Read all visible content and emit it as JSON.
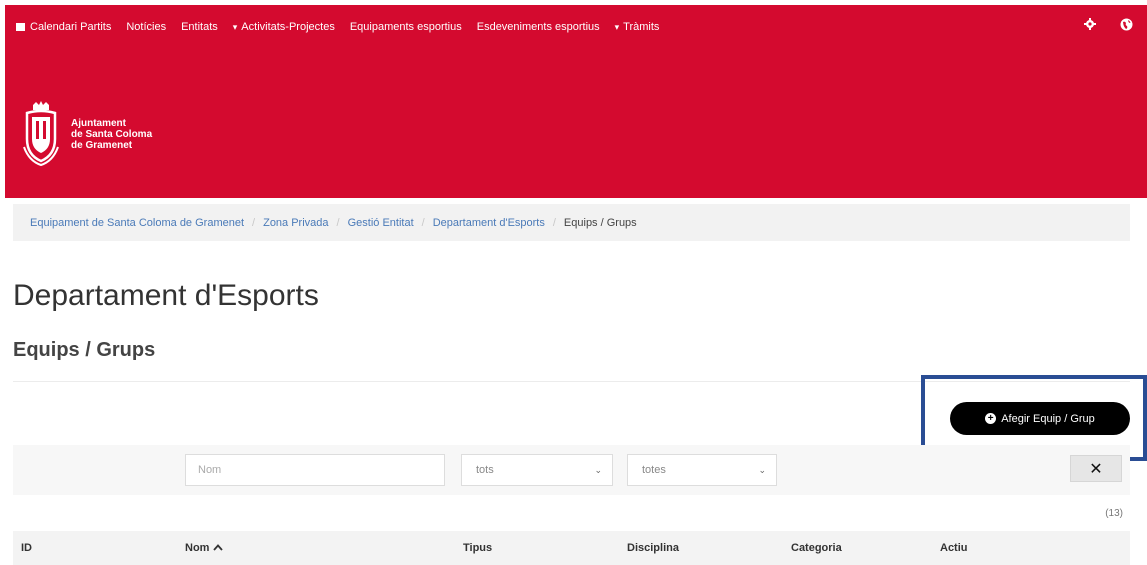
{
  "nav": {
    "items": [
      {
        "label": "Calendari Partits",
        "icon": "square-icon"
      },
      {
        "label": "Notícies"
      },
      {
        "label": "Entitats"
      },
      {
        "label": "Activitats-Projectes",
        "icon": "caret-down-icon"
      },
      {
        "label": "Equipaments esportius"
      },
      {
        "label": "Esdeveniments esportius"
      },
      {
        "label": "Tràmits",
        "icon": "caret-down-icon"
      }
    ],
    "right_icons": [
      "gear-icon",
      "globe-icon"
    ]
  },
  "logo": {
    "line1": "Ajuntament",
    "line2": "de Santa Coloma",
    "line3": "de Gramenet"
  },
  "breadcrumb": {
    "items": [
      "Equipament de Santa Coloma de Gramenet",
      "Zona Privada",
      "Gestió Entitat",
      "Departament d'Esports"
    ],
    "current": "Equips / Grups"
  },
  "page": {
    "title": "Departament d'Esports",
    "subtitle": "Equips / Grups"
  },
  "actions": {
    "add_label": "Afegir Equip / Grup"
  },
  "filters": {
    "name_placeholder": "Nom",
    "tipus_value": "tots",
    "disciplina_value": "totes",
    "clear_label": "✕"
  },
  "table": {
    "count": "(13)",
    "columns": [
      "ID",
      "Nom",
      "Tipus",
      "Disciplina",
      "Categoria",
      "Actiu"
    ]
  },
  "colors": {
    "brand": "#d40a2f",
    "highlight": "#2a4d94",
    "link": "#4a7ab8"
  }
}
